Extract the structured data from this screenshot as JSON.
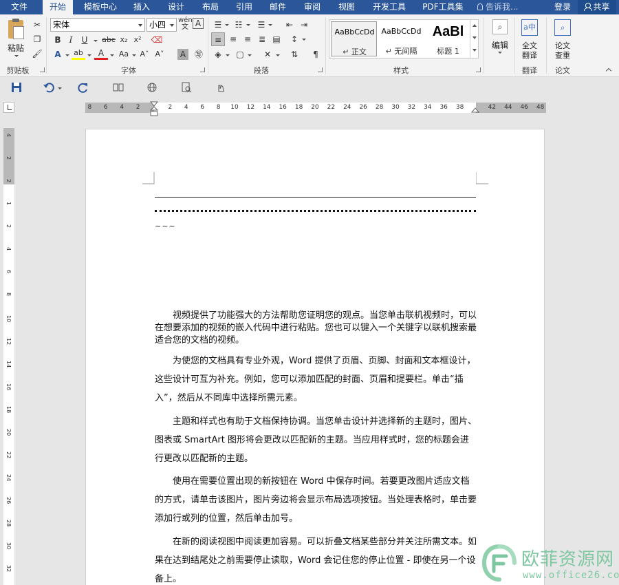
{
  "menu": {
    "tabs": [
      "文件",
      "开始",
      "模板中心",
      "插入",
      "设计",
      "布局",
      "引用",
      "邮件",
      "审阅",
      "视图",
      "开发工具",
      "PDF工具集"
    ],
    "active_tab": "开始",
    "tell_me": "告诉我...",
    "login": "登录",
    "share": "共享"
  },
  "ribbon": {
    "clipboard": {
      "paste": "粘贴",
      "label": "剪贴板"
    },
    "font": {
      "name": "宋体",
      "size": "小四",
      "label": "字体"
    },
    "paragraph": {
      "label": "段落"
    },
    "styles": {
      "label": "样式",
      "items": [
        {
          "sample": "AaBbCcDd",
          "name": "↵ 正文"
        },
        {
          "sample": "AaBbCcDd",
          "name": "↵ 无间隔"
        },
        {
          "sample": "AaBl",
          "name": "标题 1"
        }
      ]
    },
    "editing": {
      "button": "编辑"
    },
    "translate": {
      "button_line1": "全文",
      "button_line2": "翻译",
      "label": "翻译"
    },
    "paper": {
      "button_line1": "论文",
      "button_line2": "查重",
      "label": "论文"
    }
  },
  "ruler": {
    "numbers": [
      "8",
      "6",
      "4",
      "2",
      "2",
      "4",
      "6",
      "8",
      "10",
      "12",
      "14",
      "16",
      "18",
      "20",
      "22",
      "24",
      "26",
      "28",
      "30",
      "32",
      "34",
      "36",
      "38",
      "42",
      "44",
      "46",
      "48"
    ],
    "vertical_numbers": [
      "4",
      "2",
      "2",
      "1",
      "2",
      "4",
      "6",
      "8",
      "10",
      "12",
      "14",
      "16",
      "18",
      "20",
      "22",
      "24",
      "26",
      "28",
      "30",
      "32"
    ]
  },
  "document": {
    "tilde": "~~~",
    "paragraphs": [
      "视频提供了功能强大的方法帮助您证明您的观点。当您单击联机视频时，可以在想要添加的视频的嵌入代码中进行粘贴。您也可以键入一个关键字以联机搜索最适合您的文档的视频。",
      "为使您的文档具有专业外观，Word 提供了页眉、页脚、封面和文本框设计，这些设计可互为补充。例如，您可以添加匹配的封面、页眉和提要栏。单击“插入”，然后从不同库中选择所需元素。",
      "主题和样式也有助于文档保持协调。当您单击设计并选择新的主题时，图片、图表或 SmartArt 图形将会更改以匹配新的主题。当应用样式时，您的标题会进行更改以匹配新的主题。",
      "使用在需要位置出现的新按钮在 Word 中保存时间。若要更改图片适应文档的方式，请单击该图片，图片旁边将会显示布局选项按钮。当处理表格时，单击要添加行或列的位置，然后单击加号。",
      "在新的阅读视图中阅读更加容易。可以折叠文档某些部分并关注所需文本。如果在达到结尾处之前需要停止读取，Word 会记住您的停止位置 - 即使在另一个设备上。"
    ]
  },
  "watermark": {
    "title": "欧菲资源网",
    "url": "www.office26.com"
  },
  "colors": {
    "accent": "#2b579a",
    "watermark": "#7fc7a0"
  }
}
